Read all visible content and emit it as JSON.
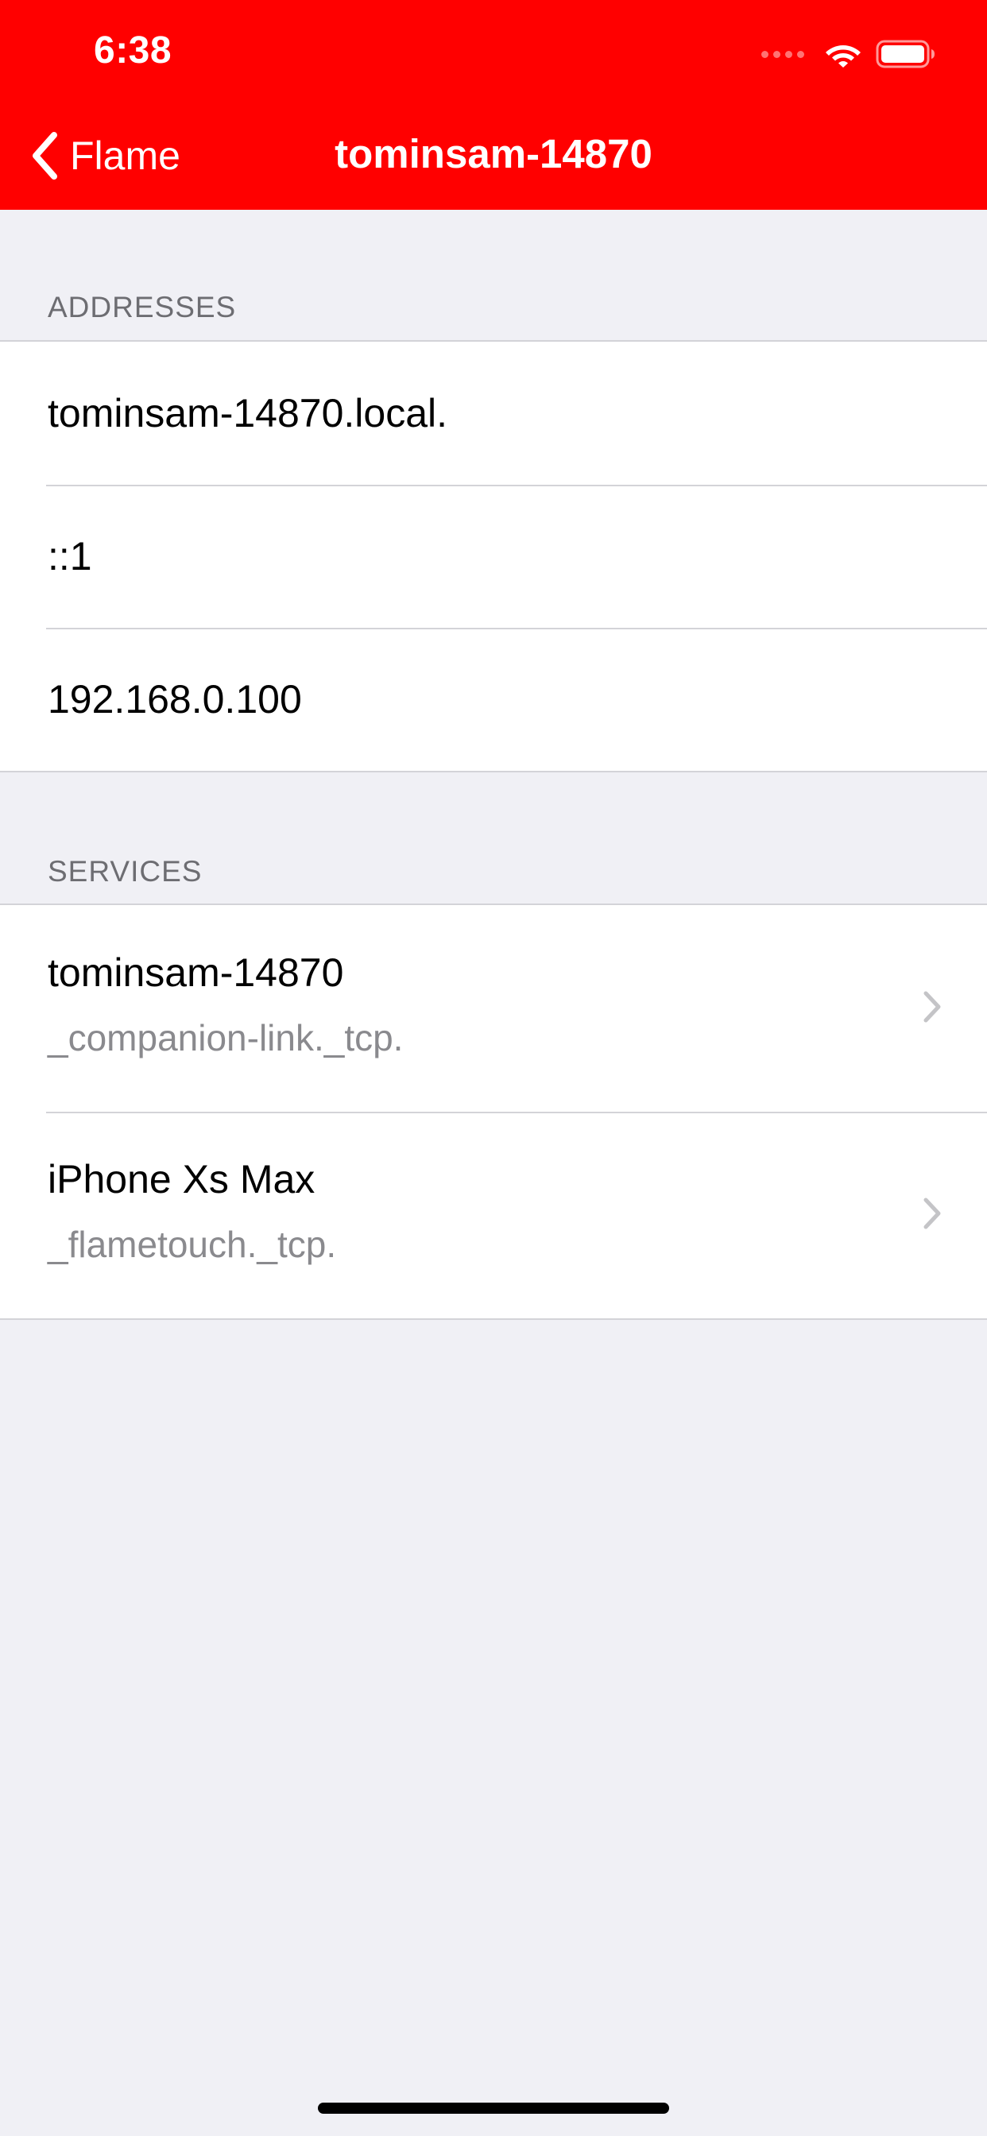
{
  "status_bar": {
    "time": "6:38"
  },
  "nav": {
    "back_label": "Flame",
    "title": "tominsam-14870"
  },
  "addresses": {
    "header": "ADDRESSES",
    "items": [
      "tominsam-14870.local.",
      "::1",
      "192.168.0.100"
    ]
  },
  "services": {
    "header": "SERVICES",
    "items": [
      {
        "name": "tominsam-14870",
        "type": "_companion-link._tcp."
      },
      {
        "name": "iPhone Xs Max",
        "type": "_flametouch._tcp."
      }
    ]
  },
  "colors": {
    "accent": "#ff0000",
    "background": "#f0f0f5",
    "secondary_text": "#8a8a8e",
    "section_header_text": "#6d6d72"
  },
  "icons": {
    "back": "chevron-left-icon",
    "disclosure": "chevron-right-icon",
    "wifi": "wifi-icon",
    "battery": "battery-icon",
    "signal": "signal-icon"
  }
}
